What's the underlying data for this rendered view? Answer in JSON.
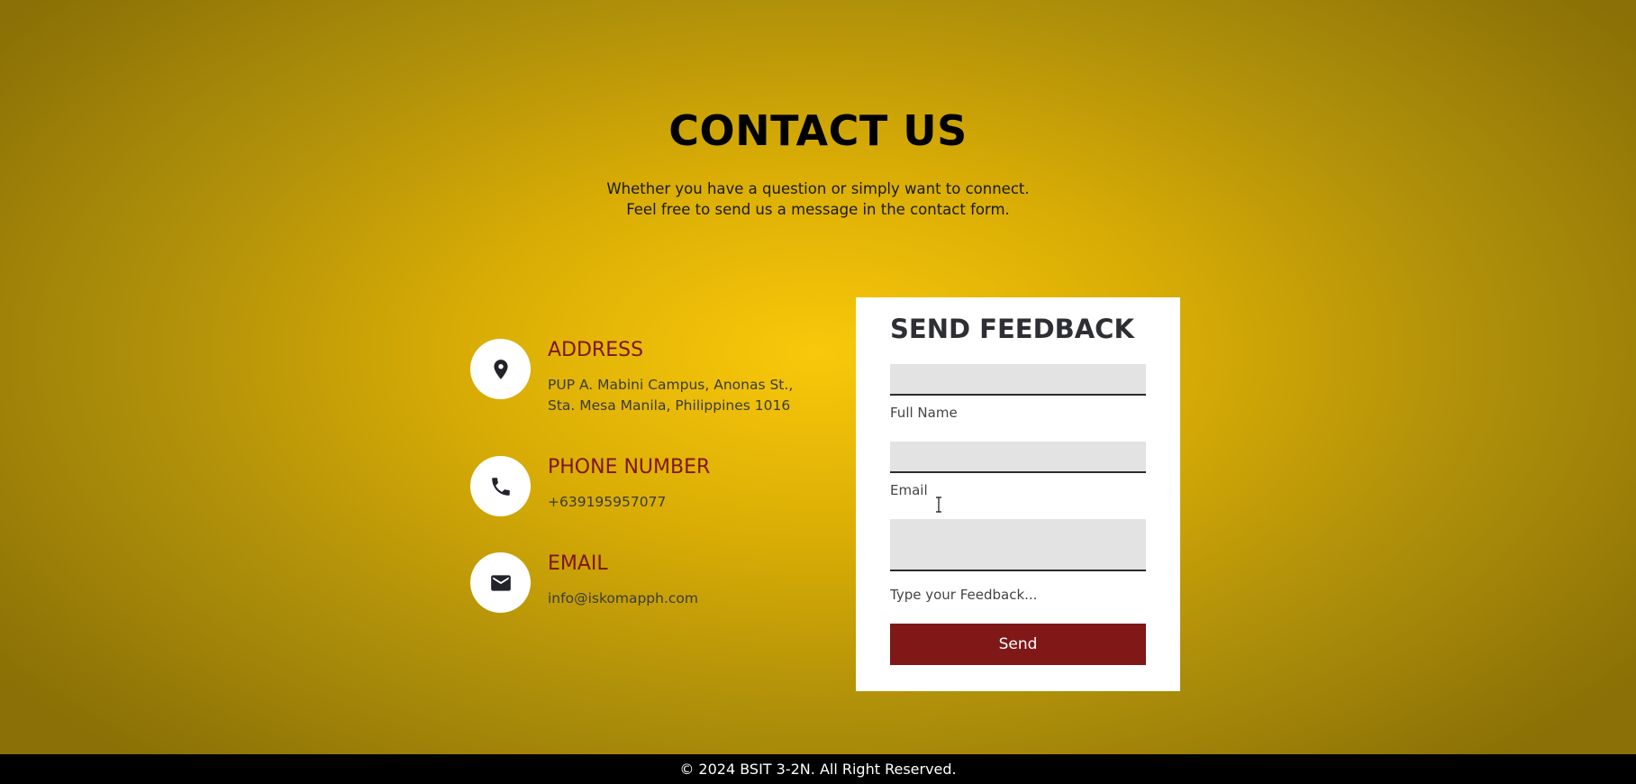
{
  "header": {
    "title": "CONTACT US",
    "subtitle_lines": [
      "Whether you have a question or simply want to connect.",
      "Feel free to send us a message in the contact form."
    ]
  },
  "contact_info": [
    {
      "icon": "location-pin-icon",
      "heading": "ADDRESS",
      "lines": [
        "PUP A. Mabini Campus, Anonas St.,",
        "Sta. Mesa Manila, Philippines 1016"
      ]
    },
    {
      "icon": "phone-icon",
      "heading": "PHONE NUMBER",
      "lines": [
        "+639195957077"
      ]
    },
    {
      "icon": "envelope-icon",
      "heading": "EMAIL",
      "lines": [
        "info@iskomapph.com"
      ]
    }
  ],
  "feedback_form": {
    "title": "SEND FEEDBACK",
    "full_name": {
      "label": "Full Name",
      "value": ""
    },
    "email": {
      "label": "Email",
      "value": ""
    },
    "feedback": {
      "label": "Type your Feedback...",
      "value": ""
    },
    "send_label": "Send"
  },
  "footer": {
    "text": "© 2024 BSIT 3-2N. All Right Reserved."
  },
  "colors": {
    "accent": "#7e1515",
    "button": "#801818",
    "background_center": "#f9c80a",
    "background_edge": "#8a7006"
  }
}
